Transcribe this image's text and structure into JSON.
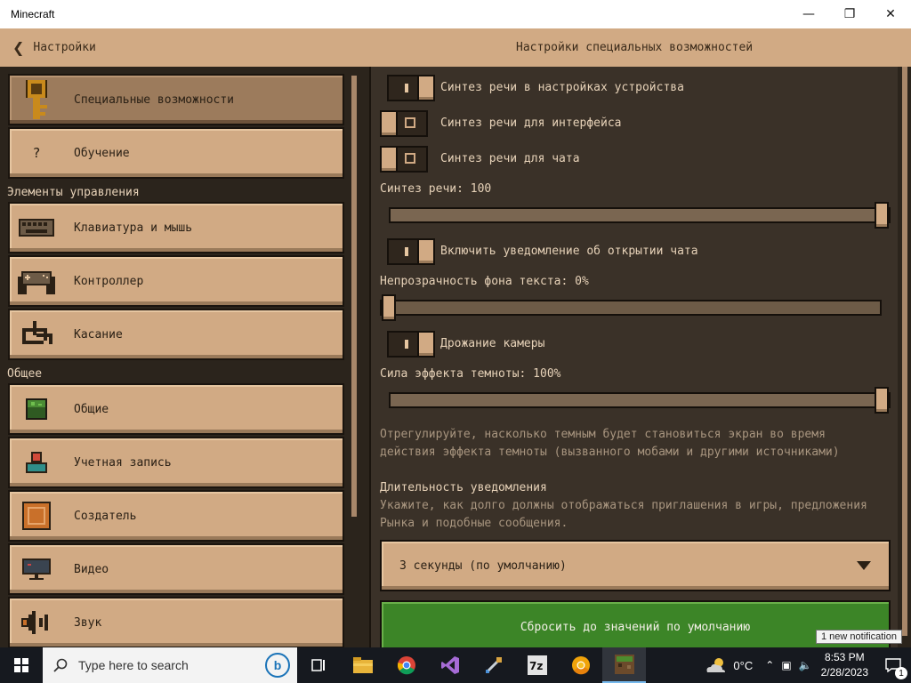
{
  "window": {
    "title": "Minecraft"
  },
  "header": {
    "back_label": "Настройки",
    "page_title": "Настройки специальных возможностей"
  },
  "sidebar": {
    "sections": [
      "Элементы управления",
      "Общее"
    ],
    "items": [
      {
        "label": "Специальные возможности",
        "icon": "key-icon",
        "active": true
      },
      {
        "label": "Обучение",
        "icon": "question-icon"
      },
      {
        "label": "Клавиатура и мышь",
        "icon": "keyboard-icon"
      },
      {
        "label": "Контроллер",
        "icon": "controller-icon"
      },
      {
        "label": "Касание",
        "icon": "touch-icon"
      },
      {
        "label": "Общие",
        "icon": "grass-block-icon"
      },
      {
        "label": "Учетная запись",
        "icon": "account-icon"
      },
      {
        "label": "Создатель",
        "icon": "command-block-icon"
      },
      {
        "label": "Видео",
        "icon": "monitor-icon"
      },
      {
        "label": "Звук",
        "icon": "speaker-icon"
      }
    ]
  },
  "settings": {
    "tts_device": {
      "label": "Синтез речи в настройках устройства",
      "on": true
    },
    "tts_ui": {
      "label": "Синтез речи для интерфейса",
      "on": false
    },
    "tts_chat": {
      "label": "Синтез речи для чата",
      "on": false
    },
    "tts_volume": {
      "label": "Синтез речи: 100",
      "value": 100,
      "max": 100
    },
    "chat_notify": {
      "label": "Включить уведомление об открытии чата",
      "on": true
    },
    "text_bg_opacity": {
      "label": "Непрозрачность фона текста: 0%",
      "value": 0,
      "max": 100
    },
    "camera_shake": {
      "label": "Дрожание камеры",
      "on": true
    },
    "darkness": {
      "label": "Сила эффекта темноты: 100%",
      "value": 100,
      "max": 100,
      "desc_line1": "Отрегулируйте, насколько темным будет становиться экран во время",
      "desc_line2": "действия эффекта темноты (вызванного мобами и другими источниками)"
    },
    "notification_duration": {
      "label": "Длительность уведомления",
      "desc_line1": "Укажите, как долго должны отображаться приглашения в игры, предложения",
      "desc_line2": "Рынка и подобные сообщения.",
      "selected": "3 секунды (по умолчанию)"
    },
    "reset_label": "Сбросить до значений по умолчанию"
  },
  "notification_tooltip": "1 new notification",
  "taskbar": {
    "search_placeholder": "Type here to search",
    "temperature": "0°C",
    "time": "8:53 PM",
    "date": "2/28/2023",
    "notification_count": "1",
    "apps": [
      "task-view-icon",
      "file-explorer-icon",
      "chrome-icon",
      "visual-studio-icon",
      "tool-icon",
      "7zip-icon",
      "chrome-canary-icon",
      "minecraft-icon"
    ]
  },
  "colors": {
    "panel": "#d1aa84",
    "accent_green": "#3c8527",
    "background": "#2b241c"
  }
}
